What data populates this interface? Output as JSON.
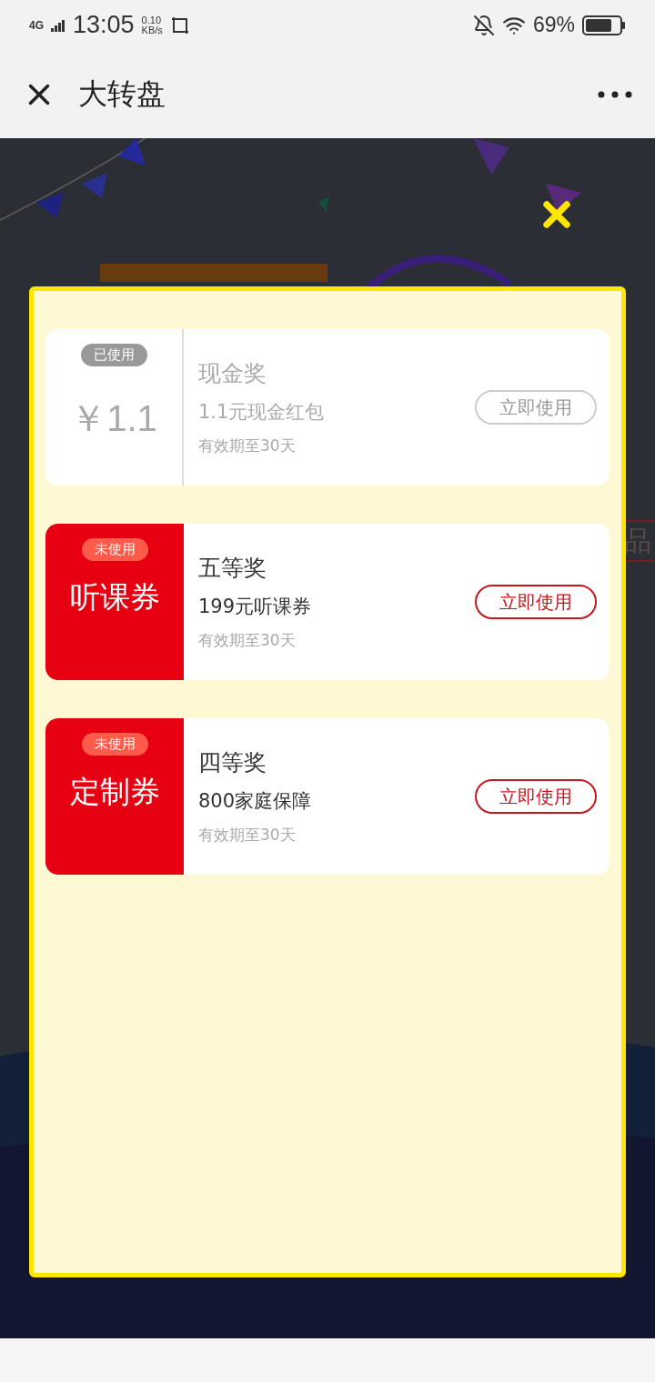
{
  "status_bar": {
    "network": "4G",
    "time": "13:05",
    "speed": "0.10",
    "speed_unit": "KB/s",
    "battery": "69%"
  },
  "nav": {
    "title": "大转盘"
  },
  "background": {
    "side_label": "品"
  },
  "prizes": [
    {
      "used": true,
      "status": "已使用",
      "face": "￥1.1",
      "kind": "cash",
      "title": "现金奖",
      "desc": "1.1元现金红包",
      "validity": "有效期至30天",
      "action": "立即使用"
    },
    {
      "used": false,
      "status": "未使用",
      "face": "听课券",
      "kind": "voucher",
      "title": "五等奖",
      "desc": "199元听课券",
      "validity": "有效期至30天",
      "action": "立即使用"
    },
    {
      "used": false,
      "status": "未使用",
      "face": "定制券",
      "kind": "voucher",
      "title": "四等奖",
      "desc": "800家庭保障",
      "validity": "有效期至30天",
      "action": "立即使用"
    }
  ]
}
